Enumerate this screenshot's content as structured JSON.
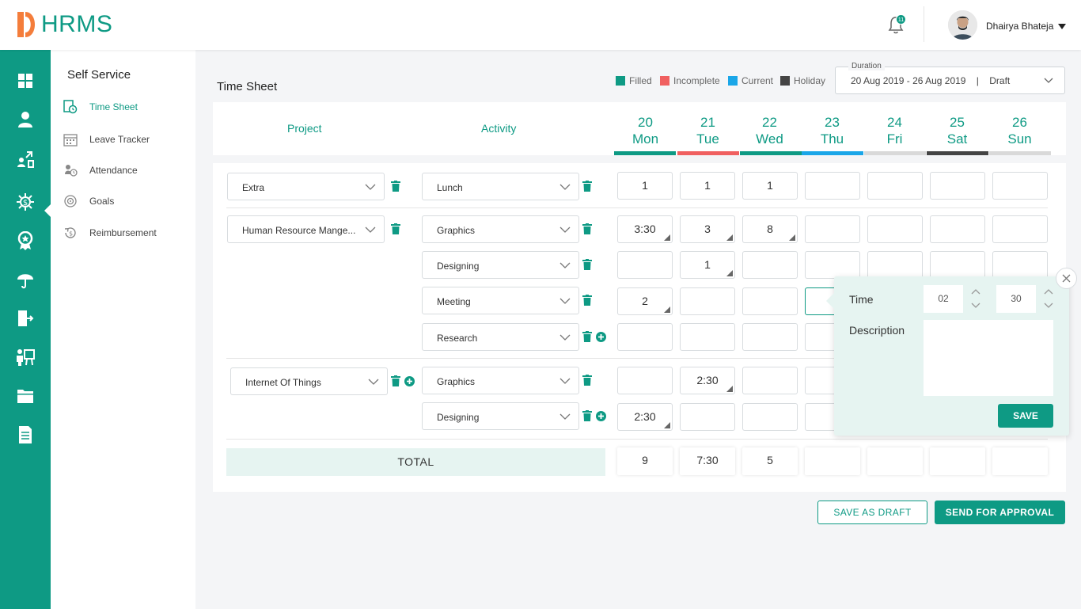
{
  "header": {
    "logo_text": "HRMS",
    "notification_count": "11",
    "user_name": "Dhairya Bhateja"
  },
  "rail_icons": [
    "dashboard-icon",
    "user-icon",
    "self-service-icon",
    "payroll-icon",
    "performance-icon",
    "insurance-icon",
    "exit-icon",
    "training-icon",
    "documents-icon",
    "reports-icon"
  ],
  "subnav": {
    "title": "Self Service",
    "items": [
      {
        "label": "Time Sheet",
        "icon": "timesheet-icon",
        "active": true
      },
      {
        "label": "Leave Tracker",
        "icon": "calendar-icon",
        "active": false
      },
      {
        "label": "Attendance",
        "icon": "attendance-icon",
        "active": false
      },
      {
        "label": "Goals",
        "icon": "target-icon",
        "active": false
      },
      {
        "label": "Reimbursement",
        "icon": "reimbursement-icon",
        "active": false
      }
    ]
  },
  "page": {
    "title": "Time Sheet",
    "legend": [
      {
        "label": "Filled",
        "color": "#0e9a84"
      },
      {
        "label": "Incomplete",
        "color": "#f06060"
      },
      {
        "label": "Current",
        "color": "#1aa6e8"
      },
      {
        "label": "Holiday",
        "color": "#444444"
      }
    ],
    "duration_label": "Duration",
    "duration_value": "20 Aug 2019 - 26 Aug 2019    |    Draft"
  },
  "table": {
    "col_project": "Project",
    "col_activity": "Activity",
    "days": [
      {
        "date": "20",
        "name": "Mon",
        "status_color": "#0e9a84"
      },
      {
        "date": "21",
        "name": "Tue",
        "status_color": "#f06060"
      },
      {
        "date": "22",
        "name": "Wed",
        "status_color": "#0e9a84"
      },
      {
        "date": "23",
        "name": "Thu",
        "status_color": "#1aa6e8"
      },
      {
        "date": "24",
        "name": "Fri",
        "status_color": "#d9d9d9"
      },
      {
        "date": "25",
        "name": "Sat",
        "status_color": "#444444"
      },
      {
        "date": "26",
        "name": "Sun",
        "status_color": "#d9d9d9"
      }
    ],
    "projects": [
      {
        "name": "Extra",
        "activities": [
          {
            "name": "Lunch",
            "hours": [
              "1",
              "1",
              "1",
              "",
              "",
              "",
              ""
            ]
          }
        ]
      },
      {
        "name": "Human Resource Mange...",
        "activities": [
          {
            "name": "Graphics",
            "hours": [
              "3:30",
              "3",
              "8",
              "",
              "",
              "",
              ""
            ]
          },
          {
            "name": "Designing",
            "hours": [
              "",
              "1",
              "",
              "",
              "",
              "",
              ""
            ]
          },
          {
            "name": "Meeting",
            "hours": [
              "2",
              "",
              "",
              "",
              "",
              "",
              ""
            ]
          },
          {
            "name": "Research",
            "hours": [
              "",
              "",
              "",
              "",
              "",
              "",
              ""
            ]
          }
        ]
      },
      {
        "name": "Internet Of Things",
        "activities": [
          {
            "name": "Graphics",
            "hours": [
              "",
              "2:30",
              "",
              "",
              "",
              "",
              ""
            ]
          },
          {
            "name": "Designing",
            "hours": [
              "2:30",
              "",
              "",
              "",
              "",
              "",
              ""
            ]
          }
        ]
      }
    ],
    "total_label": "TOTAL",
    "totals": [
      "9",
      "7:30",
      "5",
      "",
      "",
      "",
      ""
    ]
  },
  "popover": {
    "time_label": "Time",
    "hours": "02",
    "minutes": "30",
    "description_label": "Description",
    "description_value": "",
    "save_label": "SAVE"
  },
  "actions": {
    "save_draft": "SAVE AS DRAFT",
    "send_approval": "SEND FOR APPROVAL"
  }
}
